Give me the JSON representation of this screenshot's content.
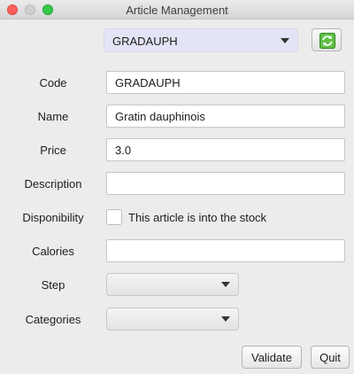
{
  "window": {
    "title": "Article Management"
  },
  "selector": {
    "selected": "GRADAUPH",
    "refresh_icon": "refresh-icon"
  },
  "form": {
    "code": {
      "label": "Code",
      "value": "GRADAUPH"
    },
    "name": {
      "label": "Name",
      "value": "Gratin dauphinois"
    },
    "price": {
      "label": "Price",
      "value": "3.0"
    },
    "description": {
      "label": "Description",
      "value": ""
    },
    "disponibility": {
      "label": "Disponibility",
      "checkbox_label": "This article is into the stock",
      "checked": false
    },
    "calories": {
      "label": "Calories",
      "value": ""
    },
    "step": {
      "label": "Step",
      "selected": ""
    },
    "categories": {
      "label": "Categories",
      "selected": ""
    }
  },
  "actions": {
    "validate_label": "Validate",
    "quit_label": "Quit"
  },
  "colors": {
    "close": "#fc605b",
    "minimize": "#d0d0d0",
    "maximize": "#35c84a",
    "selector_bg": "#e4e4f7",
    "refresh_icon": "#3aa02e"
  }
}
